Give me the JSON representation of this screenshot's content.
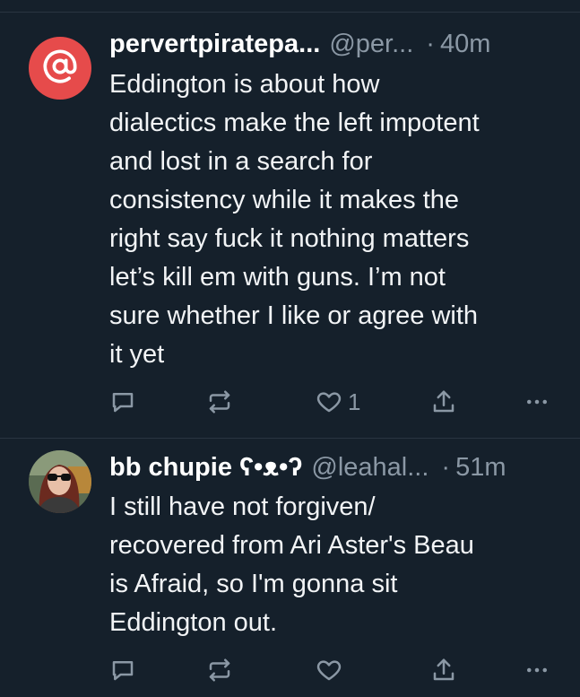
{
  "tweets": [
    {
      "display_name": "pervertpiratepa...",
      "handle": "@per...",
      "separator": "·",
      "time": "40m",
      "avatar": "at-sign-avatar",
      "avatar_color": "#e64b4b",
      "text": "Eddington is about how\ndialectics make the left impotent\nand lost in a search for\nconsistency while it makes the\nright say fuck it nothing matters\nlet’s kill em with guns. I’m not\nsure whether I like or agree with\nit yet",
      "reply_count": "",
      "retweet_count": "",
      "like_count": "1"
    },
    {
      "display_name": "bb chupie ʕ•ᴥ•ʔ",
      "handle": "@leahal...",
      "separator": "·",
      "time": "51m",
      "avatar": "profile-photo-avatar",
      "text": "I still have not forgiven/\nrecovered from Ari Aster's Beau\nis Afraid, so I'm gonna sit\nEddington out.",
      "reply_count": "",
      "retweet_count": "",
      "like_count": ""
    }
  ],
  "colors": {
    "background": "#15202b",
    "divider": "#2a3541",
    "secondary_text": "#8b98a5",
    "primary_text": "#ffffff"
  }
}
